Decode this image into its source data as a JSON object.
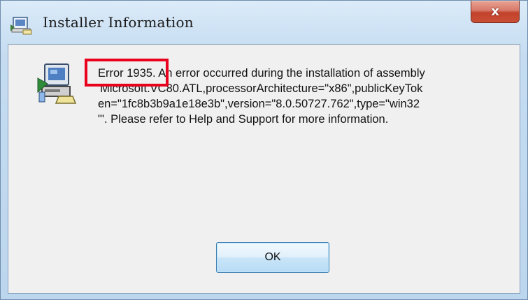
{
  "window": {
    "title": "Installer Information",
    "close_label": "x",
    "title_icon": "installer-icon"
  },
  "dialog": {
    "icon": "installer-computer-icon",
    "message_lines": [
      "Error 1935. An error occurred during the installation of assembly",
      "'Microsoft.VC80.ATL,processorArchitecture=\"x86\",publicKeyTok",
      "en=\"1fc8b3b9a1e18e3b\",version=\"8.0.50727.762\",type=\"win32",
      "\"'. Please refer to Help and Support for more information."
    ],
    "ok_label": "OK"
  },
  "annotation": {
    "highlight_color": "#e8001c",
    "highlighted_text": "Error 1935."
  },
  "colors": {
    "close_button": "#c94f34",
    "ok_border": "#3c7fb1",
    "client_background": "#f0f0f0"
  }
}
